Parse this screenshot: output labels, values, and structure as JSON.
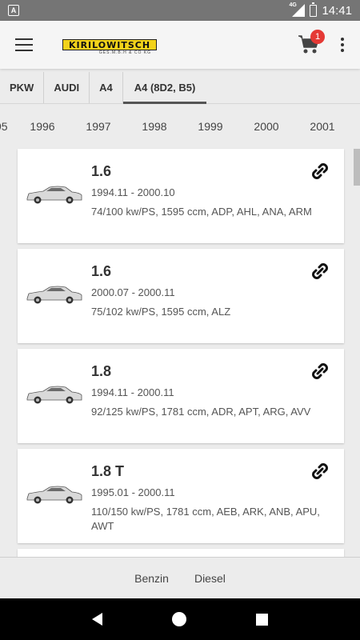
{
  "statusbar": {
    "notif_letter": "A",
    "network": "4G",
    "time": "14:41"
  },
  "appbar": {
    "logo": "KIRILOWITSCH",
    "logo_sub": "GES.M.B.H & CO KG",
    "cart_count": "1"
  },
  "breadcrumb": [
    "PKW",
    "AUDI",
    "A4",
    "A4 (8D2, B5)"
  ],
  "years": [
    "95",
    "1996",
    "1997",
    "1998",
    "1999",
    "2000",
    "2001"
  ],
  "cards": [
    {
      "title": "1.6",
      "dates": "1994.11 - 2000.10",
      "specs": "74/100 kw/PS, 1595 ccm, ADP, AHL, ANA, ARM"
    },
    {
      "title": "1.6",
      "dates": "2000.07 - 2000.11",
      "specs": "75/102 kw/PS, 1595 ccm, ALZ"
    },
    {
      "title": "1.8",
      "dates": "1994.11 - 2000.11",
      "specs": "92/125 kw/PS, 1781 ccm, ADR, APT, ARG, AVV"
    },
    {
      "title": "1.8 T",
      "dates": "1995.01 - 2000.11",
      "specs": "110/150 kw/PS, 1781 ccm, AEB, ARK, ANB, APU, AWT"
    }
  ],
  "fuel_filters": [
    "Benzin",
    "Diesel"
  ],
  "icons": {
    "menu": "menu-icon",
    "cart": "cart-icon",
    "more": "more-vert-icon",
    "link": "link-icon",
    "car": "car-icon"
  },
  "colors": {
    "logo_yellow": "#f2d21a",
    "badge_red": "#e53935",
    "status_bar": "#757575"
  }
}
